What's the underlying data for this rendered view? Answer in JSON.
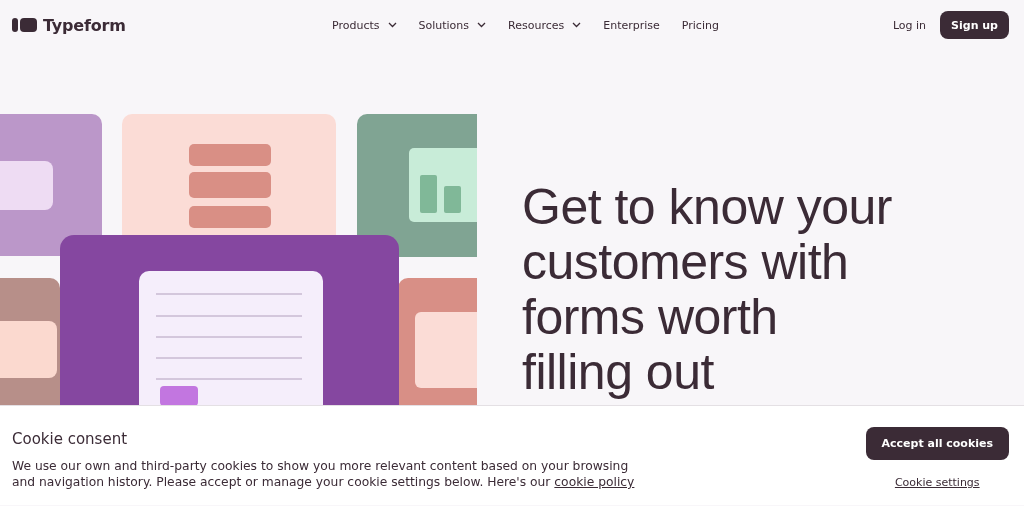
{
  "nav": {
    "logo": "Typeform",
    "links": [
      {
        "label": "Products",
        "dropdown": true
      },
      {
        "label": "Solutions",
        "dropdown": true
      },
      {
        "label": "Resources",
        "dropdown": true
      },
      {
        "label": "Enterprise",
        "dropdown": false
      },
      {
        "label": "Pricing",
        "dropdown": false
      }
    ],
    "login": "Log in",
    "signup": "Sign up"
  },
  "hero": {
    "heading": "Get to know your customers with forms worth filling out"
  },
  "cookie_banner": {
    "title": "Cookie consent",
    "text": "We use our own and third-party cookies to show you more relevant content based on your browsing and navigation history. Please accept or manage your cookie settings below. Here's our",
    "link": "cookie policy",
    "accept": "Accept all cookies",
    "settings": "Cookie settings"
  }
}
